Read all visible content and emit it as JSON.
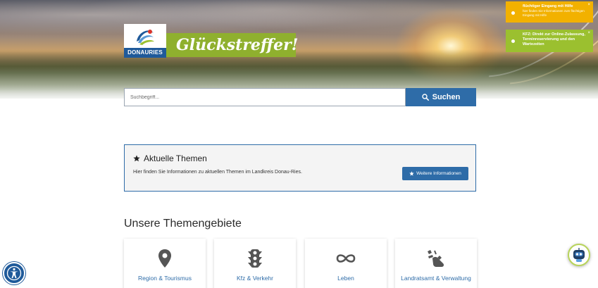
{
  "header": {
    "logo_text": "DONAURIES",
    "slogan": "Glückstreffer!"
  },
  "notifications": [
    {
      "title": "flüchtiger Eingang mit Hilfe",
      "body": "hier finden Sie Informationen zum flüchtigen Eingang mit Hilfe",
      "close": "×",
      "color": "#f2b100"
    },
    {
      "title": "KFZ: Direkt zur Online-Zulassung, Terminreservierung und den Wartezeiten",
      "body": "",
      "close": "×",
      "color": "#9bc02f"
    }
  ],
  "search": {
    "placeholder": "Suchbegriff...",
    "button_label": "Suchen",
    "icon": "search-icon"
  },
  "current_topics": {
    "title": "Aktuelle Themen",
    "icon": "star-icon",
    "text": "Hier finden Sie Informationen zu aktuellen Themen im Landkreis Donau-Ries.",
    "button_label": "Weitere Informationen"
  },
  "topic_areas": {
    "title": "Unsere Themengebiete",
    "cards": [
      {
        "label": "Region & Tourismus",
        "icon": "map-pin-icon"
      },
      {
        "label": "Kfz & Verkehr",
        "icon": "traffic-light-icon"
      },
      {
        "label": "Leben",
        "icon": "infinity-icon"
      },
      {
        "label": "Landratsamt & Verwaltung",
        "icon": "hand-signal-icon"
      }
    ]
  },
  "colors": {
    "primary_blue": "#2e6ca8",
    "logo_blue": "#1f5a9a",
    "green": "#8fb02e",
    "yellow": "#f2b100"
  }
}
